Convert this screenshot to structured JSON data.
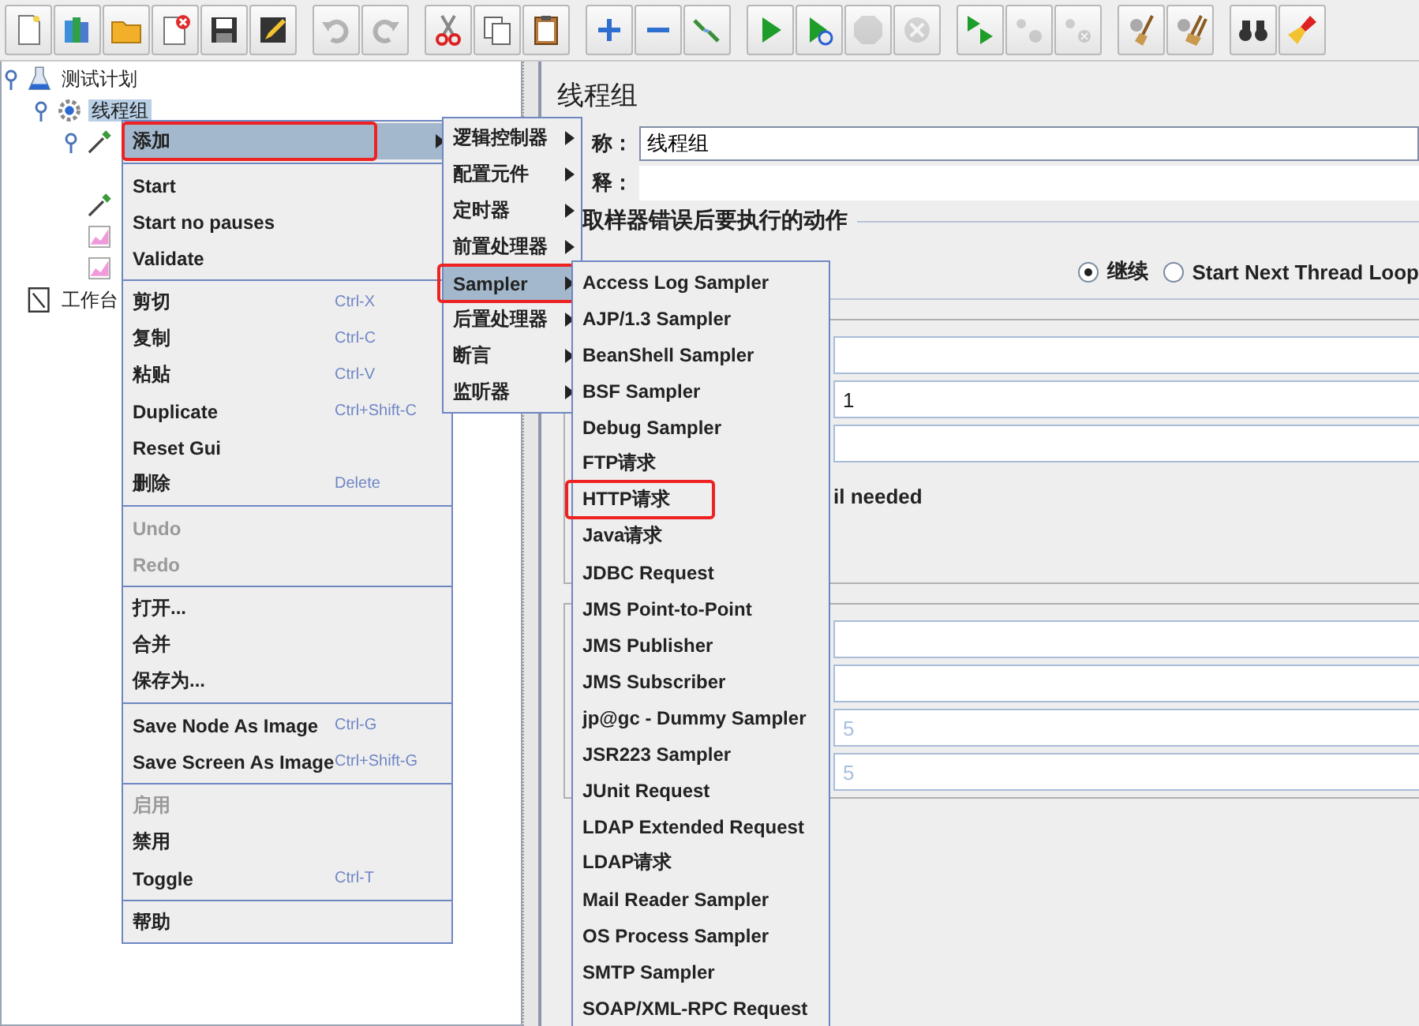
{
  "toolbar": {
    "groups": [
      [
        {
          "kind": "new",
          "disabled": false
        },
        {
          "kind": "templates",
          "disabled": false
        },
        {
          "kind": "open",
          "disabled": false
        },
        {
          "kind": "close",
          "disabled": false
        },
        {
          "kind": "save",
          "disabled": false
        },
        {
          "kind": "save-as",
          "disabled": false
        }
      ],
      [
        {
          "kind": "undo",
          "disabled": true
        },
        {
          "kind": "redo",
          "disabled": true
        }
      ],
      [
        {
          "kind": "cut",
          "disabled": false
        },
        {
          "kind": "copy",
          "disabled": false
        },
        {
          "kind": "paste",
          "disabled": false
        }
      ],
      [
        {
          "kind": "expand",
          "disabled": false
        },
        {
          "kind": "collapse",
          "disabled": false
        },
        {
          "kind": "toggle",
          "disabled": false
        }
      ],
      [
        {
          "kind": "start",
          "disabled": false
        },
        {
          "kind": "start-no-pauses",
          "disabled": false
        },
        {
          "kind": "stop",
          "disabled": true
        },
        {
          "kind": "shutdown",
          "disabled": true
        }
      ],
      [
        {
          "kind": "remote-start",
          "disabled": false
        },
        {
          "kind": "remote-stop",
          "disabled": true
        },
        {
          "kind": "remote-shutdown",
          "disabled": true
        }
      ],
      [
        {
          "kind": "clear",
          "disabled": false
        },
        {
          "kind": "clear-all",
          "disabled": false
        }
      ],
      [
        {
          "kind": "search",
          "disabled": false
        },
        {
          "kind": "reset",
          "disabled": false
        }
      ]
    ]
  },
  "tree": [
    {
      "label": "测试计划",
      "kind": "plan",
      "selected": false,
      "expanded": true,
      "children": [
        {
          "label": "线程组",
          "kind": "thread-group",
          "selected": true,
          "expanded": true,
          "children": [
            {
              "kind": "sampler",
              "expanded": true
            },
            {
              "kind": "spacer"
            },
            {
              "kind": "sampler"
            },
            {
              "kind": "listener"
            },
            {
              "kind": "listener"
            }
          ]
        }
      ]
    },
    {
      "label": "工作台",
      "kind": "workbench",
      "selected": false
    }
  ],
  "panel": {
    "title": "线程组",
    "name_label": "称：",
    "name_value": "线程组",
    "comment_label": "释：",
    "error_action": {
      "title": "取样器错误后要执行的动作",
      "options": [
        {
          "label": "继续",
          "selected": true
        },
        {
          "label": "Start Next Thread Loop",
          "selected": false
        }
      ]
    },
    "thread_fields": [
      {
        "kind": "field"
      },
      {
        "kind": "field",
        "value": "1"
      },
      {
        "kind": "field"
      }
    ],
    "note": "il needed",
    "schedule_fields": [
      {
        "kind": "field"
      },
      {
        "kind": "field"
      },
      {
        "kind": "field",
        "value": "5"
      },
      {
        "kind": "field",
        "value": "5"
      }
    ]
  },
  "context_menu": {
    "groups": [
      [
        {
          "label": "添加",
          "submenu": true,
          "highlighted": true,
          "disabled": false,
          "annotated": true
        }
      ],
      [
        {
          "label": "Start",
          "highlighted": false,
          "disabled": false
        },
        {
          "label": "Start no pauses",
          "highlighted": false,
          "disabled": false
        },
        {
          "label": "Validate",
          "highlighted": false,
          "disabled": false
        }
      ],
      [
        {
          "label": "剪切",
          "shortcut": "Ctrl-X",
          "highlighted": false,
          "disabled": false
        },
        {
          "label": "复制",
          "shortcut": "Ctrl-C",
          "highlighted": false,
          "disabled": false
        },
        {
          "label": "粘贴",
          "shortcut": "Ctrl-V",
          "highlighted": false,
          "disabled": false
        },
        {
          "label": "Duplicate",
          "shortcut": "Ctrl+Shift-C",
          "highlighted": false,
          "disabled": false
        },
        {
          "label": "Reset Gui",
          "highlighted": false,
          "disabled": false
        },
        {
          "label": "删除",
          "shortcut": "Delete",
          "highlighted": false,
          "disabled": false
        }
      ],
      [
        {
          "label": "Undo",
          "highlighted": false,
          "disabled": true
        },
        {
          "label": "Redo",
          "highlighted": false,
          "disabled": true
        }
      ],
      [
        {
          "label": "打开...",
          "highlighted": false,
          "disabled": false
        },
        {
          "label": "合并",
          "highlighted": false,
          "disabled": false
        },
        {
          "label": "保存为...",
          "highlighted": false,
          "disabled": false
        }
      ],
      [
        {
          "label": "Save Node As Image",
          "shortcut": "Ctrl-G",
          "highlighted": false,
          "disabled": false
        },
        {
          "label": "Save Screen As Image",
          "shortcut": "Ctrl+Shift-G",
          "highlighted": false,
          "disabled": false
        }
      ],
      [
        {
          "label": "启用",
          "highlighted": false,
          "disabled": true
        },
        {
          "label": "禁用",
          "highlighted": false,
          "disabled": false
        },
        {
          "label": "Toggle",
          "shortcut": "Ctrl-T",
          "highlighted": false,
          "disabled": false
        }
      ],
      [
        {
          "label": "帮助",
          "highlighted": false,
          "disabled": false
        }
      ]
    ]
  },
  "add_submenu": {
    "items": [
      {
        "label": "逻辑控制器",
        "submenu": true,
        "highlighted": false
      },
      {
        "label": "配置元件",
        "submenu": true,
        "highlighted": false
      },
      {
        "label": "定时器",
        "submenu": true,
        "highlighted": false
      },
      {
        "label": "前置处理器",
        "submenu": true,
        "highlighted": false
      },
      {
        "label": "Sampler",
        "submenu": true,
        "highlighted": true,
        "annotated": true
      },
      {
        "label": "后置处理器",
        "submenu": true,
        "highlighted": false
      },
      {
        "label": "断言",
        "submenu": true,
        "highlighted": false
      },
      {
        "label": "监听器",
        "submenu": true,
        "highlighted": false
      }
    ]
  },
  "sampler_submenu": {
    "items": [
      {
        "label": "Access Log Sampler",
        "highlighted": false
      },
      {
        "label": "AJP/1.3 Sampler",
        "highlighted": false
      },
      {
        "label": "BeanShell Sampler",
        "highlighted": false
      },
      {
        "label": "BSF Sampler",
        "highlighted": false
      },
      {
        "label": "Debug Sampler",
        "highlighted": false
      },
      {
        "label": "FTP请求",
        "highlighted": false
      },
      {
        "label": "HTTP请求",
        "highlighted": false,
        "annotated": true
      },
      {
        "label": "Java请求",
        "highlighted": false
      },
      {
        "label": "JDBC Request",
        "highlighted": false
      },
      {
        "label": "JMS Point-to-Point",
        "highlighted": false
      },
      {
        "label": "JMS Publisher",
        "highlighted": false
      },
      {
        "label": "JMS Subscriber",
        "highlighted": false
      },
      {
        "label": "jp@gc - Dummy Sampler",
        "highlighted": false
      },
      {
        "label": "JSR223 Sampler",
        "highlighted": false
      },
      {
        "label": "JUnit Request",
        "highlighted": false
      },
      {
        "label": "LDAP Extended Request",
        "highlighted": false
      },
      {
        "label": "LDAP请求",
        "highlighted": false
      },
      {
        "label": "Mail Reader Sampler",
        "highlighted": false
      },
      {
        "label": "OS Process Sampler",
        "highlighted": false
      },
      {
        "label": "SMTP Sampler",
        "highlighted": false
      },
      {
        "label": "SOAP/XML-RPC Request",
        "highlighted": false
      }
    ]
  }
}
